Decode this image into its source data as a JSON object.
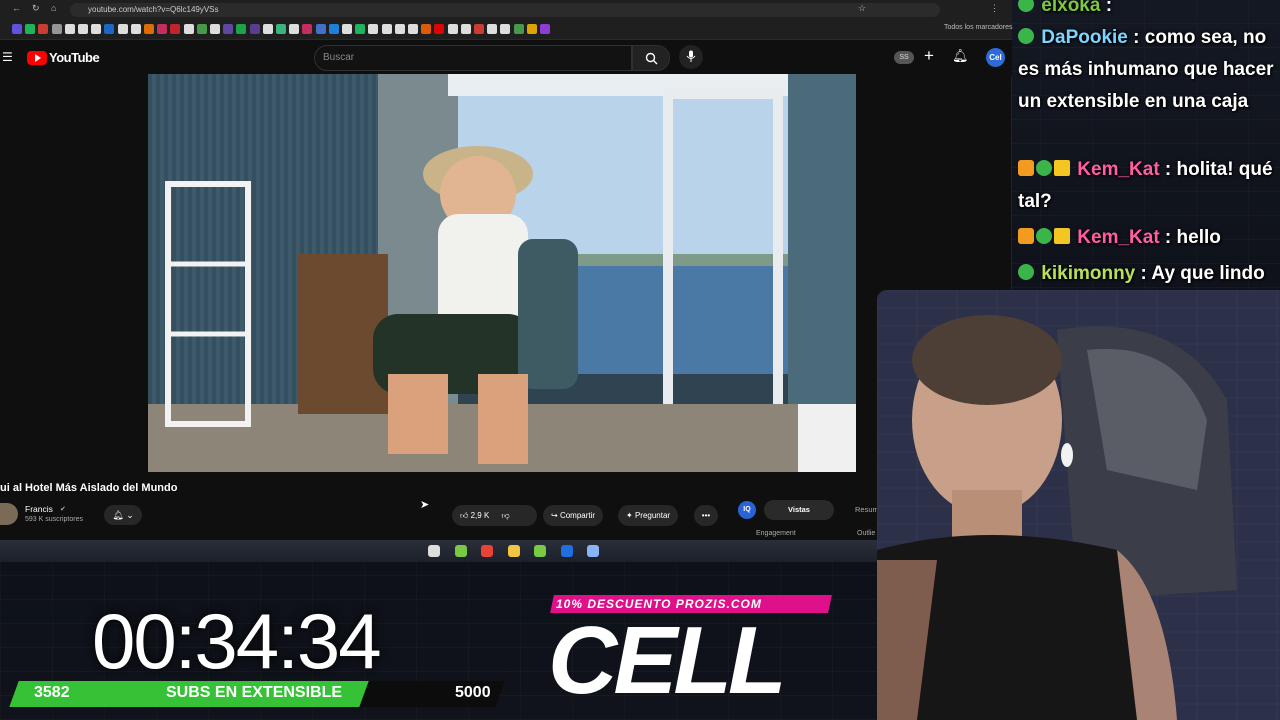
{
  "browser": {
    "url": "youtube.com/watch?v=Q6lc149yVSs",
    "bookmarks_folder": "Todos los marcadores",
    "bookmark_colors": [
      "#6b5cff",
      "#1ecf6a",
      "#ea4335",
      "#aaaaaa",
      "#ffffff",
      "#ffffff",
      "#ffffff",
      "#1a73e8",
      "#ffffff",
      "#ffffff",
      "#ff7a00",
      "#e1306c",
      "#e2242b",
      "#ffffff",
      "#4caf50",
      "#ffffff",
      "#6b4fbb",
      "#1db954",
      "#6441a5",
      "#ffffff",
      "#3ecf8e",
      "#ffffff",
      "#e1306c",
      "#4a7ce8",
      "#1e90ff",
      "#ffffff",
      "#1ecf6a",
      "#ffffff",
      "#ffffff",
      "#ffffff",
      "#ffffff",
      "#ff6600",
      "#ff0000",
      "#ffffff",
      "#ffffff",
      "#ea4335",
      "#ffffff",
      "#ffffff",
      "#4caf50",
      "#fbbc04",
      "#a142f4"
    ]
  },
  "youtube": {
    "logo_text": "YouTube",
    "search_placeholder": "Buscar",
    "ss_badge": "SS",
    "avatar_text": "Cel"
  },
  "video": {
    "title": "ui al Hotel Más Aislado del Mundo",
    "channel": "Francis",
    "subscribers": "593 K suscriptores",
    "likes": "2,9 K",
    "share_label": "Compartir",
    "ask_label": "Preguntar",
    "more_label": "•••"
  },
  "side_panel": {
    "badge": "IQ",
    "tab_active": "Vistas",
    "tab_other": "Resum",
    "metric_left": "Engagement",
    "metric_right": "Outlie"
  },
  "taskbar": {
    "icon_colors": [
      "#dddddd",
      "#7ac943",
      "#ea4335",
      "#f4c542",
      "#7ac943",
      "#1f6fe0",
      "#8ab4f8"
    ]
  },
  "chat": [
    {
      "user": "elxoka",
      "color": "#7ac943",
      "text": ":",
      "badges": [
        "sub"
      ]
    },
    {
      "user": "DaPookie",
      "color": "#7fd4ff",
      "text": ": como sea, no es más inhumano que hacer un extensible en una caja",
      "badges": [
        "sub"
      ]
    },
    {
      "user": "Kem_Kat",
      "color": "#ff5fa0",
      "text": ": holita! qué tal?",
      "badges": [
        "box",
        "sub",
        "crown"
      ]
    },
    {
      "user": "Kem_Kat",
      "color": "#ff5fa0",
      "text": ": hello",
      "badges": [
        "box",
        "sub",
        "crown"
      ]
    },
    {
      "user": "kikimonny",
      "color": "#b8e05a",
      "text": ": Ay que lindo",
      "badges": [
        "sub"
      ]
    }
  ],
  "overlay": {
    "timer": "00:34:34",
    "subs_current": "3582",
    "subs_label": "SUBS EN EXTENSIBLE",
    "subs_goal": "5000",
    "subs_progress": 0.7164,
    "promo": "10% DESCUENTO PROZIS.COM",
    "sponsor": "CELL"
  }
}
